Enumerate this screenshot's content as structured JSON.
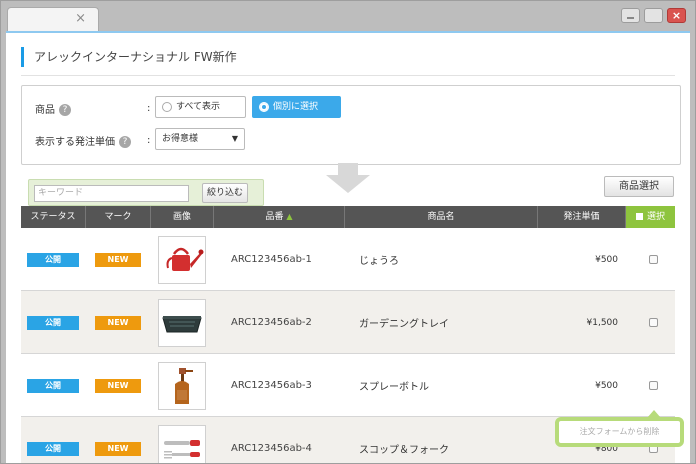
{
  "window": {
    "tab_close": "×",
    "close_symbol": "×"
  },
  "page": {
    "title": "アレックインターナショナル FW新作"
  },
  "filter": {
    "product_label": "商品",
    "colon": ":",
    "show_all": "すべて表示",
    "select_individually": "個別に選択",
    "price_label": "表示する発注単価",
    "price_value": "お得意様"
  },
  "search": {
    "placeholder": "キーワード",
    "filter_button": "絞り込む",
    "product_select_button": "商品選択"
  },
  "table": {
    "headers": {
      "status": "ステータス",
      "mark": "マーク",
      "image": "画像",
      "sku": "品番",
      "sku_sort": "▲",
      "name": "商品名",
      "price": "発注単価",
      "select": "選択"
    },
    "rows": [
      {
        "status": "公開",
        "mark": "NEW",
        "image": "watering-can",
        "sku": "ARC123456ab-1",
        "name": "じょうろ",
        "price": "¥500"
      },
      {
        "status": "公開",
        "mark": "NEW",
        "image": "garden-tray",
        "sku": "ARC123456ab-2",
        "name": "ガーデニングトレイ",
        "price": "¥1,500"
      },
      {
        "status": "公開",
        "mark": "NEW",
        "image": "spray-bottle",
        "sku": "ARC123456ab-3",
        "name": "スプレーボトル",
        "price": "¥500"
      },
      {
        "status": "公開",
        "mark": "NEW",
        "image": "scoop-fork",
        "sku": "ARC123456ab-4",
        "name": "スコップ＆フォーク",
        "price": "¥800"
      }
    ]
  },
  "tooltip": {
    "remove_from_order": "注文フォームから削除"
  },
  "colors": {
    "accent_blue": "#2aa4e5",
    "new_orange": "#ee9a0e",
    "select_green": "#8ec43e",
    "header_dark": "#555555"
  }
}
